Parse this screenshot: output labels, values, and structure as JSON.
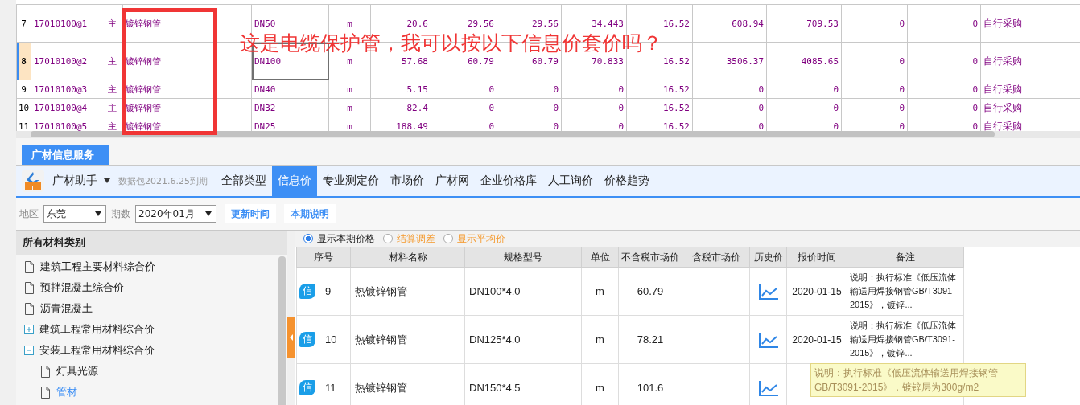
{
  "grid": {
    "rows": [
      {
        "index": "7",
        "current": false,
        "spec_focused": false,
        "cells": [
          "17010100@1",
          "主",
          "镀锌钢管",
          "DN50",
          "m",
          "20.6",
          "29.56",
          "29.56",
          "34.443",
          "16.52",
          "608.94",
          "709.53",
          "0",
          "0",
          "自行采购"
        ]
      },
      {
        "index": "8",
        "current": true,
        "spec_focused": true,
        "cells": [
          "17010100@2",
          "主",
          "镀锌钢管",
          "DN100",
          "m",
          "57.68",
          "60.79",
          "60.79",
          "70.833",
          "16.52",
          "3506.37",
          "4085.65",
          "0",
          "0",
          "自行采购"
        ]
      },
      {
        "index": "9",
        "current": false,
        "spec_focused": false,
        "cells": [
          "17010100@3",
          "主",
          "镀锌钢管",
          "DN40",
          "m",
          "5.15",
          "0",
          "0",
          "0",
          "16.52",
          "0",
          "0",
          "0",
          "0",
          "自行采购"
        ]
      },
      {
        "index": "10",
        "current": false,
        "spec_focused": false,
        "cells": [
          "17010100@4",
          "主",
          "镀锌钢管",
          "DN32",
          "m",
          "82.4",
          "0",
          "0",
          "0",
          "16.52",
          "0",
          "0",
          "0",
          "0",
          "自行采购"
        ]
      },
      {
        "index": "11",
        "current": false,
        "spec_focused": false,
        "cells": [
          "17010100@5",
          "主",
          "镀锌钢管",
          "DN25",
          "m",
          "188.49",
          "0",
          "0",
          "0",
          "16.52",
          "0",
          "0",
          "0",
          "0",
          "自行采购"
        ]
      }
    ]
  },
  "annotation": {
    "text": "这是电缆保护管，我可以按以下信息价套价吗？"
  },
  "panel": {
    "title": "广材信息服务"
  },
  "toolbar": {
    "app": "广材助手",
    "package": "数据包2021.6.25到期",
    "tabs": [
      {
        "label": "全部类型",
        "selected": false
      },
      {
        "label": "信息价",
        "selected": true
      },
      {
        "label": "专业测定价",
        "selected": false
      },
      {
        "label": "市场价",
        "selected": false
      },
      {
        "label": "广材网",
        "selected": false
      },
      {
        "label": "企业价格库",
        "selected": false
      },
      {
        "label": "人工询价",
        "selected": false
      },
      {
        "label": "价格趋势",
        "selected": false
      }
    ]
  },
  "filters": {
    "region_label": "地区",
    "region": "东莞",
    "period_label": "期数",
    "period": "2020年01月",
    "buttons": [
      "更新时间",
      "本期说明"
    ]
  },
  "categories": {
    "title": "所有材料类别",
    "items": [
      {
        "label": "建筑工程主要材料综合价",
        "kind": "leaf",
        "selected": false
      },
      {
        "label": "预拌混凝土综合价",
        "kind": "leaf",
        "selected": false
      },
      {
        "label": "沥青混凝土",
        "kind": "leaf",
        "selected": false
      },
      {
        "label": "建筑工程常用材料综合价",
        "kind": "group",
        "expanded": false,
        "selected": false
      },
      {
        "label": "安装工程常用材料综合价",
        "kind": "group",
        "expanded": true,
        "selected": false,
        "children": [
          {
            "label": "灯具光源",
            "kind": "leaf",
            "selected": false
          },
          {
            "label": "管材",
            "kind": "leaf",
            "selected": true
          }
        ]
      }
    ]
  },
  "options": [
    {
      "label": "显示本期价格",
      "selected": true
    },
    {
      "label": "结算调差",
      "selected": false
    },
    {
      "label": "显示平均价",
      "selected": false
    }
  ],
  "price_table": {
    "columns": [
      "序号",
      "材料名称",
      "规格型号",
      "单位",
      "不含税市场价",
      "含税市场价",
      "历史价",
      "报价时间",
      "备注"
    ],
    "rows": [
      {
        "badge": "信",
        "no": "9",
        "name": "热镀锌钢管",
        "spec": "DN100*4.0",
        "unit": "m",
        "price": "60.79",
        "date": "2020-01-15",
        "note": "说明：执行标准《低压流体输送用焊接钢管GB/T3091-2015》，镀锌..."
      },
      {
        "badge": "信",
        "no": "10",
        "name": "热镀锌钢管",
        "spec": "DN125*4.0",
        "unit": "m",
        "price": "78.21",
        "date": "2020-01-15",
        "note": "说明：执行标准《低压流体输送用焊接钢管GB/T3091-2015》，镀锌..."
      },
      {
        "badge": "信",
        "no": "11",
        "name": "热镀锌钢管",
        "spec": "DN150*4.5",
        "unit": "m",
        "price": "101.6"
      }
    ]
  },
  "tooltip": {
    "text": "说明：执行标准《低压流体输送用焊接钢管GB/T3091-2015》，镀锌层为300g/m2"
  }
}
